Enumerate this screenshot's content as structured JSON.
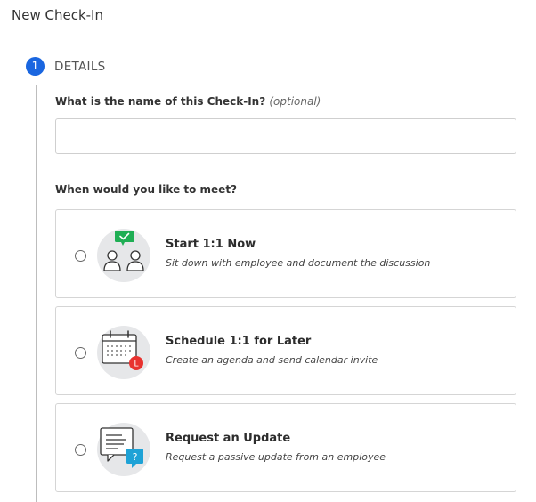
{
  "page": {
    "title": "New Check-In"
  },
  "step": {
    "number": "1",
    "label": "DETAILS"
  },
  "name_field": {
    "label": "What is the name of this Check-In?",
    "optional": "(optional)",
    "value": "",
    "placeholder": ""
  },
  "meet": {
    "label": "When would you like to meet?",
    "options": [
      {
        "title": "Start 1:1 Now",
        "description": "Sit down with employee and document the discussion",
        "icon": "people-checkmark-icon"
      },
      {
        "title": "Schedule 1:1 for Later",
        "description": "Create an agenda and send calendar invite",
        "icon": "calendar-icon"
      },
      {
        "title": "Request an Update",
        "description": "Request a passive update from an employee",
        "icon": "document-question-icon"
      }
    ],
    "calendar_badge": "L",
    "question_badge": "?"
  },
  "colors": {
    "accent": "#1a66e0",
    "check_green": "#1fae54",
    "badge_red": "#e8322f",
    "question_blue": "#1ea2d6",
    "illustration_bg": "#e6e7e9"
  }
}
